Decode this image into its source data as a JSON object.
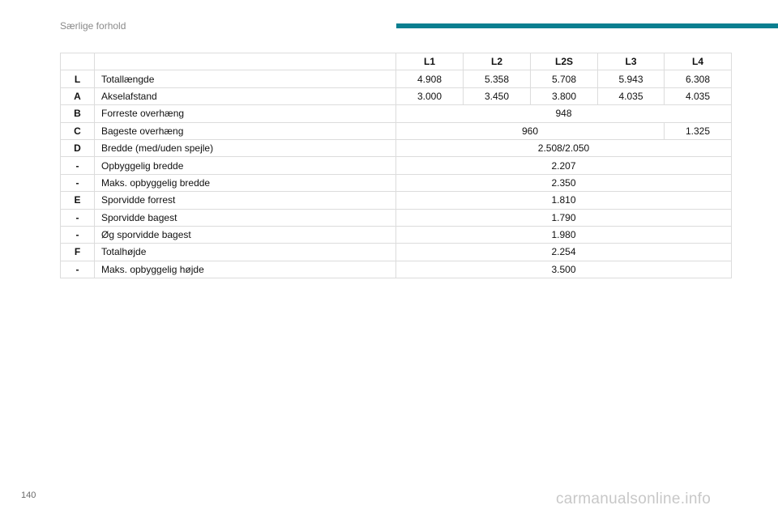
{
  "header": {
    "title": "Særlige forhold",
    "accent_color": "#0a7f90"
  },
  "table": {
    "columns": [
      "L1",
      "L2",
      "L2S",
      "L3",
      "L4"
    ],
    "rows": [
      {
        "code": "L",
        "label": "Totallængde",
        "values": [
          "4.908",
          "5.358",
          "5.708",
          "5.943",
          "6.308"
        ]
      },
      {
        "code": "A",
        "label": "Akselafstand",
        "values": [
          "3.000",
          "3.450",
          "3.800",
          "4.035",
          "4.035"
        ]
      },
      {
        "code": "B",
        "label": "Forreste overhæng",
        "values": [
          "948"
        ]
      },
      {
        "code": "C",
        "label": "Bageste overhæng",
        "values": [
          "960",
          "1.325"
        ]
      },
      {
        "code": "D",
        "label": "Bredde (med/uden spejle)",
        "values": [
          "2.508/2.050"
        ]
      },
      {
        "code": "-",
        "label": "Opbyggelig bredde",
        "values": [
          "2.207"
        ]
      },
      {
        "code": "-",
        "label": "Maks. opbyggelig bredde",
        "values": [
          "2.350"
        ]
      },
      {
        "code": "E",
        "label": "Sporvidde forrest",
        "values": [
          "1.810"
        ]
      },
      {
        "code": "-",
        "label": "Sporvidde bagest",
        "values": [
          "1.790"
        ]
      },
      {
        "code": "-",
        "label": "Øg sporvidde bagest",
        "values": [
          "1.980"
        ]
      },
      {
        "code": "F",
        "label": "Totalhøjde",
        "values": [
          "2.254"
        ]
      },
      {
        "code": "-",
        "label": "Maks. opbyggelig højde",
        "values": [
          "3.500"
        ]
      }
    ]
  },
  "footer": {
    "page_number": "140",
    "watermark": "carmanualsonline.info"
  }
}
